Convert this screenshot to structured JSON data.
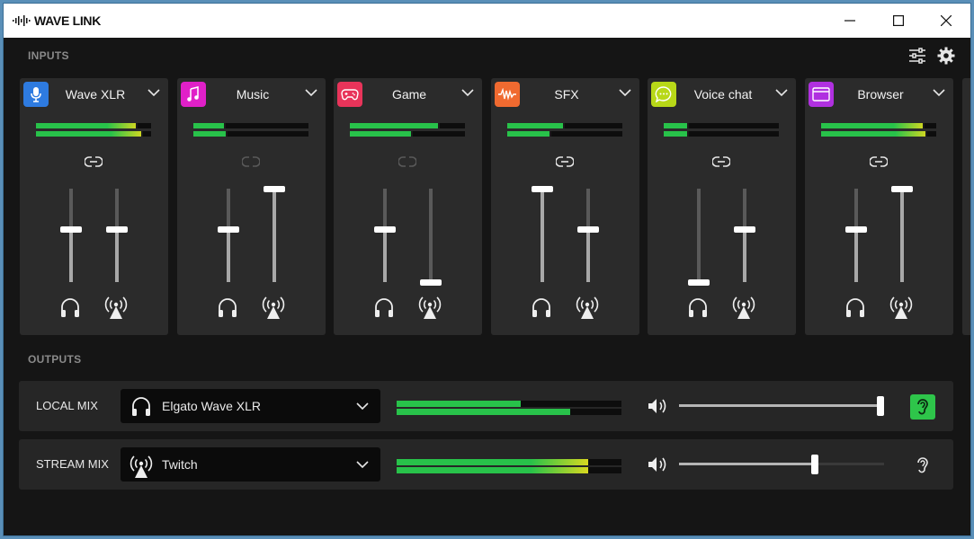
{
  "app": {
    "title": "WAVE LINK"
  },
  "inputs": {
    "label": "INPUTS",
    "channels": [
      {
        "name": "Wave XLR",
        "icon": "microphone-icon",
        "color": "#2e7be0",
        "meter": [
          0.88,
          0.93
        ],
        "monitor_level": 0.43,
        "stream_level": 0.43,
        "linked": true
      },
      {
        "name": "Music",
        "icon": "music-note-icon",
        "color": "#e020c8",
        "meter": [
          0.28,
          0.3
        ],
        "monitor_level": 0.43,
        "stream_level": 1.0,
        "linked": false
      },
      {
        "name": "Game",
        "icon": "gamepad-icon",
        "color": "#e8345a",
        "meter": [
          0.78,
          0.55
        ],
        "monitor_level": 0.43,
        "stream_level": 0.0,
        "linked": false
      },
      {
        "name": "SFX",
        "icon": "waveform-icon",
        "color": "#f06a30",
        "meter": [
          0.5,
          0.38
        ],
        "monitor_level": 1.0,
        "stream_level": 0.43,
        "linked": true
      },
      {
        "name": "Voice chat",
        "icon": "chat-bubble-icon",
        "color": "#b8d818",
        "meter": [
          0.22,
          0.22
        ],
        "monitor_level": 0.0,
        "stream_level": 0.43,
        "linked": true
      },
      {
        "name": "Browser",
        "icon": "browser-window-icon",
        "color": "#b030e0",
        "meter": [
          0.9,
          0.92
        ],
        "monitor_level": 0.43,
        "stream_level": 1.0,
        "linked": true
      }
    ]
  },
  "outputs": {
    "label": "OUTPUTS",
    "mixes": [
      {
        "label": "LOCAL MIX",
        "device": "Elgato Wave XLR",
        "device_icon": "headphones-icon",
        "meter": [
          0.55,
          0.77
        ],
        "volume": 1.0,
        "ear_active": true
      },
      {
        "label": "STREAM MIX",
        "device": "Twitch",
        "device_icon": "broadcast-icon",
        "meter": [
          0.85,
          0.85
        ],
        "volume": 0.67,
        "ear_active": false
      }
    ]
  },
  "colors": {
    "accent": "#2ec54a",
    "meter_green": "#28c24a",
    "meter_yellow": "#d8d820",
    "background": "#151515",
    "panel": "#2b2b2b"
  }
}
